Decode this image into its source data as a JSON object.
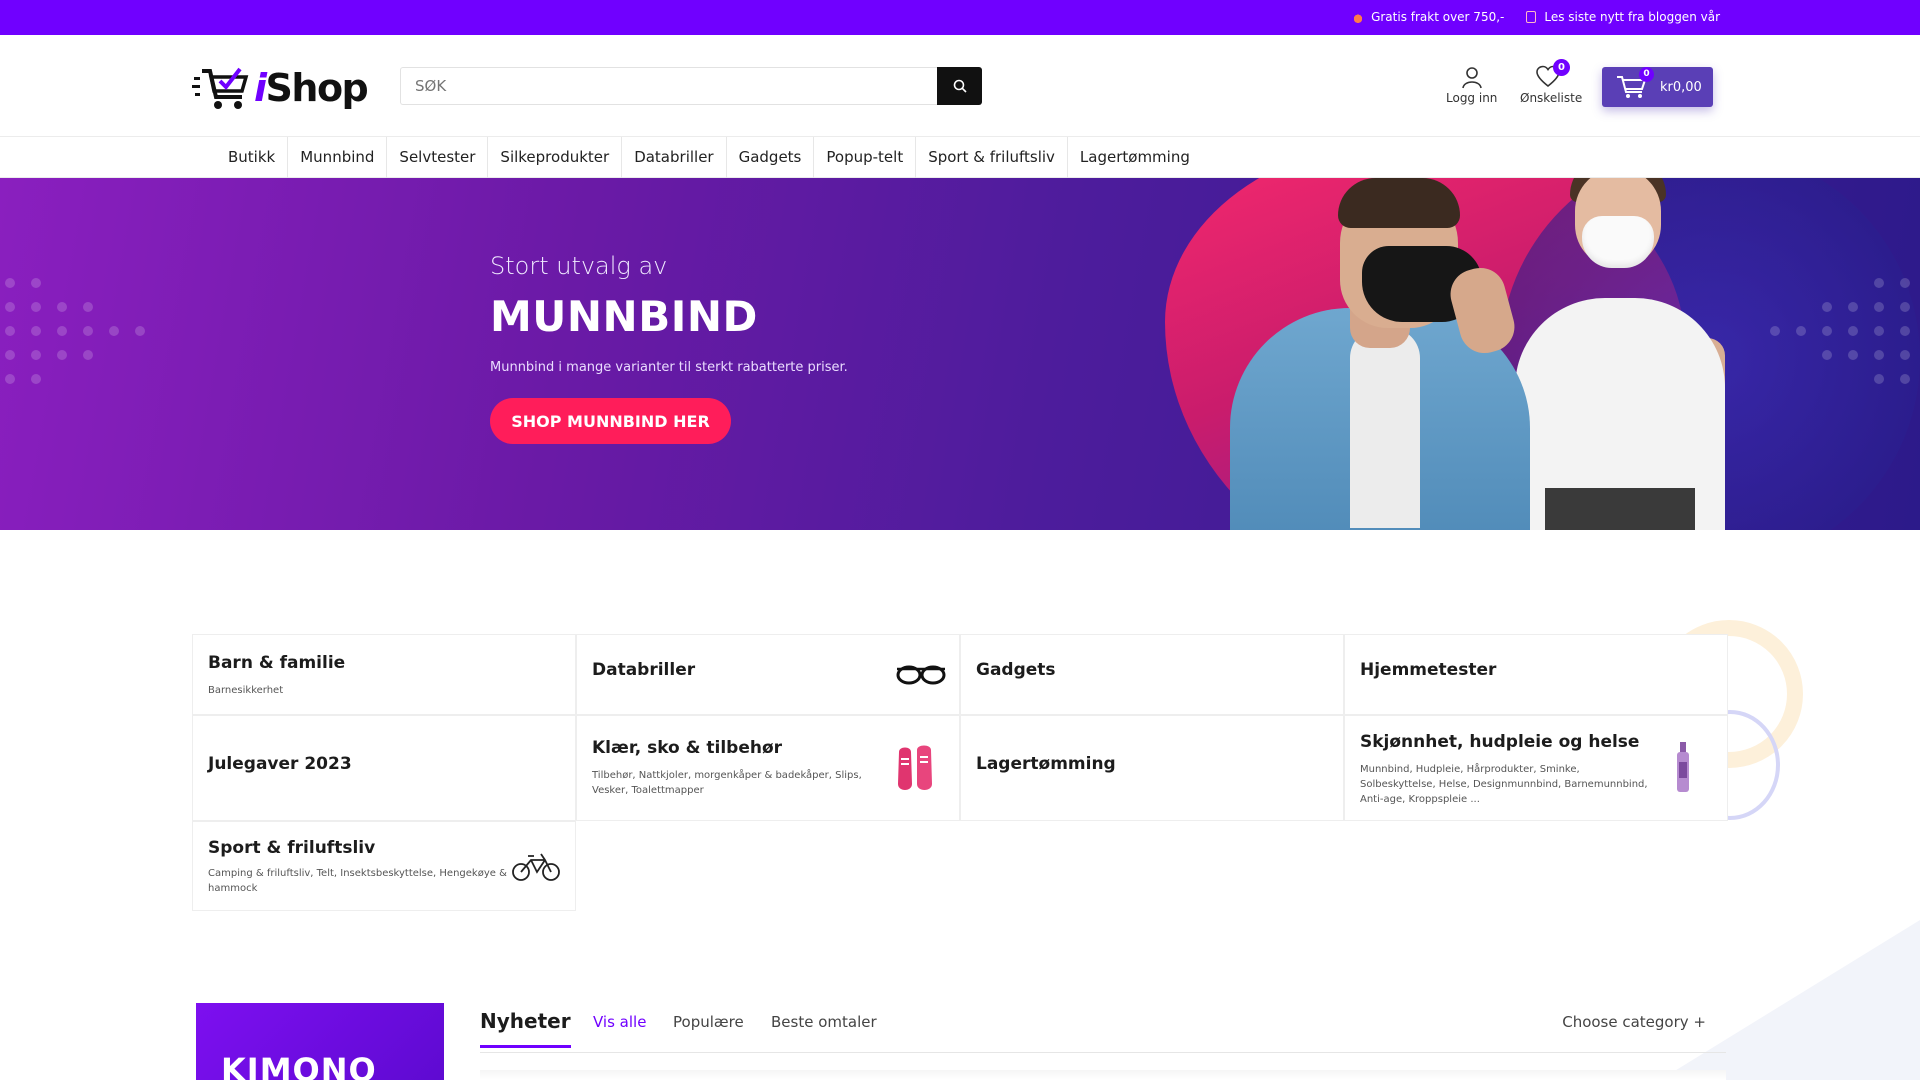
{
  "topbar": {
    "free_shipping": "Gratis frakt over 750,-",
    "blog": "Les siste nytt fra bloggen vår"
  },
  "header": {
    "logo_i": "i",
    "logo_shop": "Shop",
    "search_placeholder": "SØK",
    "login": "Logg inn",
    "wishlist": "Ønskeliste",
    "wishlist_count": "0",
    "cart_count": "0",
    "cart_amount": "kr0,00"
  },
  "nav": {
    "items": [
      "Butikk",
      "Munnbind",
      "Selvtester",
      "Silkeprodukter",
      "Databriller",
      "Gadgets",
      "Popup-telt",
      "Sport & friluftsliv",
      "Lagertømming"
    ]
  },
  "hero": {
    "subtitle": "Stort utvalg av",
    "title": "MUNNBIND",
    "description": "Munnbind i mange varianter til sterkt rabatterte priser.",
    "cta": "SHOP MUNNBIND HER"
  },
  "categories": [
    {
      "name": "Barn & familie",
      "subs": "Barnesikkerhet"
    },
    {
      "name": "Databriller",
      "subs": ""
    },
    {
      "name": "Gadgets",
      "subs": ""
    },
    {
      "name": "Hjemmetester",
      "subs": ""
    },
    {
      "name": "Julegaver 2023",
      "subs": ""
    },
    {
      "name": "Klær, sko & tilbehør",
      "subs": "Tilbehør, Nattkjoler, morgenkåper & badekåper, Slips, Vesker, Toalettmapper"
    },
    {
      "name": "Lagertømming",
      "subs": ""
    },
    {
      "name": "Skjønnhet, hudpleie og helse",
      "subs": "Munnbind, Hudpleie, Hårprodukter, Sminke, Solbeskyttelse, Helse, Designmunnbind, Barnemunnbind, Anti-age, Kroppspleie ..."
    },
    {
      "name": "Sport & friluftsliv",
      "subs": "Camping & friluftsliv, Telt, Insektsbeskyttelse, Hengekøye & hammock"
    }
  ],
  "promo": {
    "label": "KIMONO"
  },
  "tabs": {
    "new": "Nyheter",
    "see_all": "Vis alle",
    "popular": "Populære",
    "best_reviews": "Beste omtaler",
    "choose_category": "Choose category +"
  },
  "colors": {
    "accent": "#7000ff",
    "cta": "#ff1d5a",
    "cart": "#5a3fb6"
  }
}
